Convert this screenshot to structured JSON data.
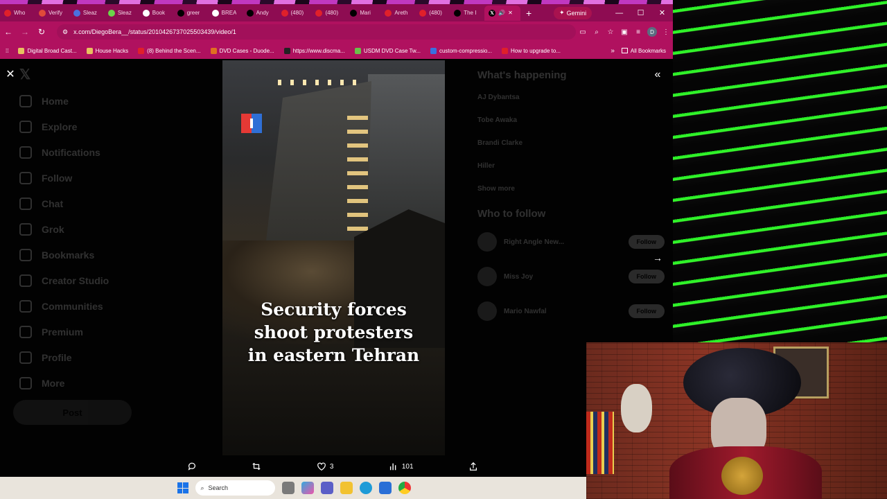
{
  "tabs": [
    {
      "label": "Who",
      "icon": "youtube-icon",
      "color": "#e0202a"
    },
    {
      "label": "Verify",
      "icon": "gmail-icon",
      "color": "#e04a3a"
    },
    {
      "label": "Sleaz",
      "icon": "app-icon",
      "color": "#4a70e0"
    },
    {
      "label": "Sleaz",
      "icon": "rumble-icon",
      "color": "#6bd44a"
    },
    {
      "label": "Book",
      "icon": "star-icon",
      "color": "#ffffff"
    },
    {
      "label": "greer",
      "icon": "x-icon",
      "color": "#000000"
    },
    {
      "label": "BREA",
      "icon": "gp-icon",
      "color": "#ffffff"
    },
    {
      "label": "Andy",
      "icon": "x-icon",
      "color": "#000000"
    },
    {
      "label": "(480)",
      "icon": "youtube-icon",
      "color": "#e0202a"
    },
    {
      "label": "(480)",
      "icon": "youtube-icon",
      "color": "#e0202a"
    },
    {
      "label": "Mari",
      "icon": "x-icon",
      "color": "#000000"
    },
    {
      "label": "Areth",
      "icon": "youtube-icon",
      "color": "#e0202a"
    },
    {
      "label": "(480)",
      "icon": "youtube-icon",
      "color": "#e0202a"
    },
    {
      "label": "The I",
      "icon": "x-icon",
      "color": "#000000"
    }
  ],
  "active_tab": {
    "icon": "x-icon",
    "close": "✕"
  },
  "new_tab": "+",
  "gemini_label": "Gemini",
  "url": "x.com/DiegoBera__/status/2010426737025503439/video/1",
  "bookmarks": [
    {
      "label": "Digital Broad Cast...",
      "color": "#e8c060"
    },
    {
      "label": "House Hacks",
      "color": "#e8c060"
    },
    {
      "label": "(8) Behind the Scen...",
      "color": "#e0202a"
    },
    {
      "label": "DVD Cases - Duode...",
      "color": "#e07020"
    },
    {
      "label": "https://www.discma...",
      "color": "#222222"
    },
    {
      "label": "USDM DVD Case Tw...",
      "color": "#6bbf4a"
    },
    {
      "label": "custom-compressio...",
      "color": "#3a70e0"
    },
    {
      "label": "How to upgrade to...",
      "color": "#e0202a"
    }
  ],
  "all_bookmarks": "All Bookmarks",
  "x_sidebar": [
    "Home",
    "Explore",
    "Notifications",
    "Follow",
    "Chat",
    "Grok",
    "Bookmarks",
    "Creator Studio",
    "Communities",
    "Premium",
    "Profile",
    "More"
  ],
  "x_post_button": "Post",
  "x_right": {
    "heading": "What's happening",
    "trends": [
      "AJ Dybantsa",
      "Tobe Awaka",
      "Brandi Clarke",
      "Hiller"
    ],
    "show_more": "Show more",
    "who_to_follow": "Who to follow",
    "accounts": [
      "Right Angle New...",
      "Miss Joy",
      "Mario Nawfal"
    ],
    "follow": "Follow"
  },
  "video": {
    "caption_lines": [
      "Security forces",
      "shoot protesters",
      "in eastern Tehran"
    ]
  },
  "actions": {
    "likes": "3",
    "views": "101"
  },
  "taskbar": {
    "search_placeholder": "Search"
  }
}
